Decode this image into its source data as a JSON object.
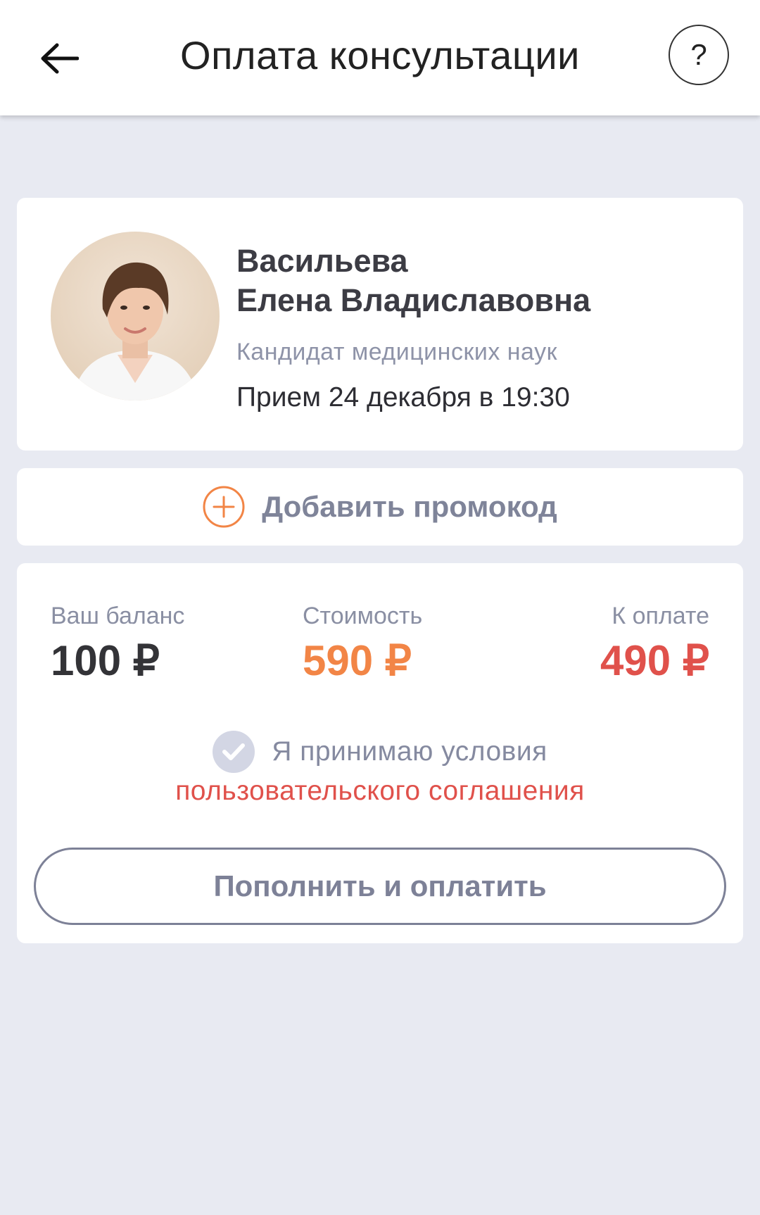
{
  "header": {
    "title": "Оплата консультации",
    "back_icon": "arrow-left-icon",
    "help_label": "?"
  },
  "doctor": {
    "last_name": "Васильева",
    "first_names": "Елена Владиславовна",
    "degree": "Кандидат медицинских наук",
    "appointment": "Прием 24 декабря в 19:30",
    "photo_icon": "doctor-photo"
  },
  "promo": {
    "icon": "plus-circle-icon",
    "label": "Добавить промокод"
  },
  "payment": {
    "balance_label": "Ваш баланс",
    "balance_value": "100 ₽",
    "cost_label": "Стоимость",
    "cost_value": "590 ₽",
    "topay_label": "К оплате",
    "topay_value": "490 ₽",
    "agree_icon": "checkmark-circle-icon",
    "agree_text": "Я принимаю условия",
    "agree_link": "пользовательского соглашения",
    "submit_label": "Пополнить и оплатить"
  },
  "colors": {
    "background": "#e8eaf2",
    "accent_orange": "#f28546",
    "accent_red": "#e0514b",
    "muted_text": "#8a8fa3"
  }
}
